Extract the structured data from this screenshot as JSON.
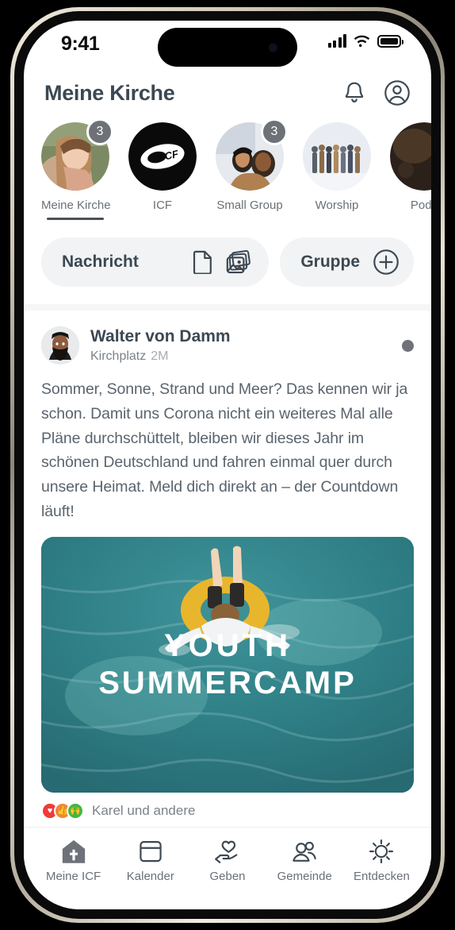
{
  "status_bar": {
    "time": "9:41",
    "signal_icon": "cellular-bars-icon",
    "wifi_icon": "wifi-icon",
    "battery_icon": "battery-full-icon"
  },
  "header": {
    "title": "Meine Kirche",
    "notifications_icon": "bell-icon",
    "profile_icon": "account-circle-icon"
  },
  "stories": {
    "items": [
      {
        "label": "Meine Kirche",
        "badge": "3",
        "active": true,
        "image": "portrait-woman"
      },
      {
        "label": "ICF",
        "badge": "",
        "active": false,
        "image": "icf-logo"
      },
      {
        "label": "Small Group",
        "badge": "3",
        "active": false,
        "image": "two-people"
      },
      {
        "label": "Worship",
        "badge": "",
        "active": false,
        "image": "group-of-people"
      },
      {
        "label": "Podc",
        "badge": "",
        "active": false,
        "image": "microphone"
      }
    ]
  },
  "compose": {
    "message_label": "Nachricht",
    "document_icon": "document-icon",
    "photos_icon": "photos-icon",
    "group_label": "Gruppe",
    "add_icon": "plus-circle-icon"
  },
  "post": {
    "author": "Walter von Damm",
    "place": "Kirchplatz",
    "time": "2M",
    "options_icon": "status-dot-icon",
    "text": "Sommer, Sonne, Strand und Meer? Das kennen wir ja schon. Damit uns Corona nicht ein weiteres Mal alle Pläne durchschüttelt, bleiben wir dieses Jahr im schönen Deutschland und fahren einmal quer durch unsere Heimat. Meld dich direkt an – der Countdown läuft!",
    "card": {
      "title_line1": "YOUTH",
      "title_line2": "SUMMERCAMP",
      "image_description": "person-in-yellow-float-ring-on-teal-water"
    },
    "reactions": {
      "items": [
        {
          "name": "heart-reaction",
          "glyph": "♥",
          "color": "#ef3a3a"
        },
        {
          "name": "thumbs-up-reaction",
          "glyph": "👍",
          "color": "#f0873a"
        },
        {
          "name": "praise-reaction",
          "glyph": "🙌",
          "color": "#3fb83f"
        }
      ],
      "text": "Karel und andere"
    }
  },
  "bottom_nav": {
    "items": [
      {
        "label": "Meine ICF",
        "icon": "church-icon",
        "active": true
      },
      {
        "label": "Kalender",
        "icon": "calendar-icon",
        "active": false
      },
      {
        "label": "Geben",
        "icon": "hand-heart-icon",
        "active": false
      },
      {
        "label": "Gemeinde",
        "icon": "people-icon",
        "active": false
      },
      {
        "label": "Entdecken",
        "icon": "sun-icon",
        "active": false
      }
    ]
  },
  "colors": {
    "text_dark": "#3c4853",
    "text_muted": "#6a7076",
    "pill_bg": "#f2f3f4",
    "card_teal": "#2e7a80",
    "badge_gray": "#6e7278"
  }
}
